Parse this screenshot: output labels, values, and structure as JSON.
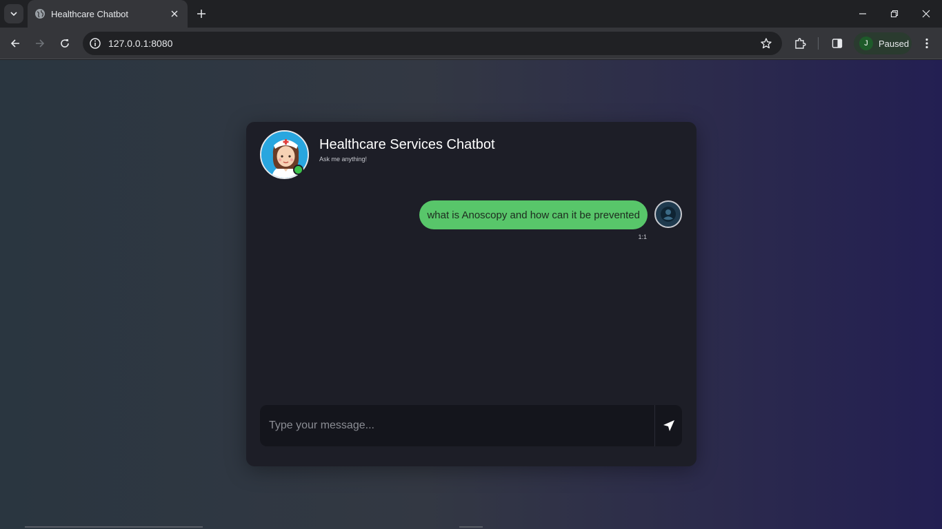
{
  "browser": {
    "tab_title": "Healthcare Chatbot",
    "url": "127.0.0.1:8080",
    "profile_initial": "J",
    "profile_status": "Paused"
  },
  "chat": {
    "title": "Healthcare Services Chatbot",
    "subtitle": "Ask me anything!",
    "messages": [
      {
        "sender": "user",
        "text": "what is Anoscopy and how can it be prevented",
        "time": "1:1"
      }
    ],
    "input_placeholder": "Type your message...",
    "input_value": ""
  },
  "colors": {
    "user_bubble": "#58c66a",
    "online_status": "#3bc24b",
    "panel": "#1d1e27"
  },
  "icons": {
    "bot_avatar": "nurse-avatar",
    "user_avatar": "user-icon",
    "send": "send-icon"
  }
}
